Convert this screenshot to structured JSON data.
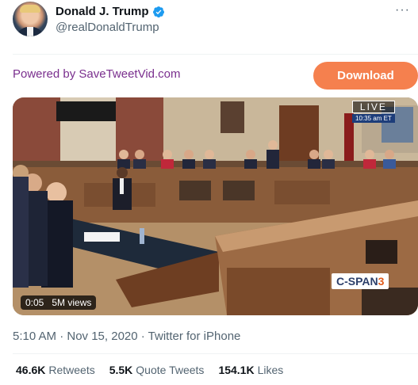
{
  "tweet": {
    "display_name": "Donald J. Trump",
    "handle": "@realDonaldTrump",
    "timestamp": "5:10 AM · Nov 15, 2020 · Twitter for iPhone"
  },
  "promo": {
    "powered_by": "Powered by SaveTweetVid.com",
    "download_label": "Download"
  },
  "video": {
    "elapsed": "0:05",
    "views": "5M views",
    "live_label": "LIVE",
    "live_time": "10:35 am ET",
    "network": "C-SPAN",
    "network_channel": "3"
  },
  "stats": {
    "retweets_count": "46.6K",
    "retweets_label": "Retweets",
    "quotes_count": "5.5K",
    "quotes_label": "Quote Tweets",
    "likes_count": "154.1K",
    "likes_label": "Likes"
  },
  "colors": {
    "download_bg": "#f5804e",
    "powered_text": "#7a2f8e",
    "verified": "#1d9bf0"
  },
  "icons": [
    "verified-badge-icon",
    "more-icon"
  ]
}
